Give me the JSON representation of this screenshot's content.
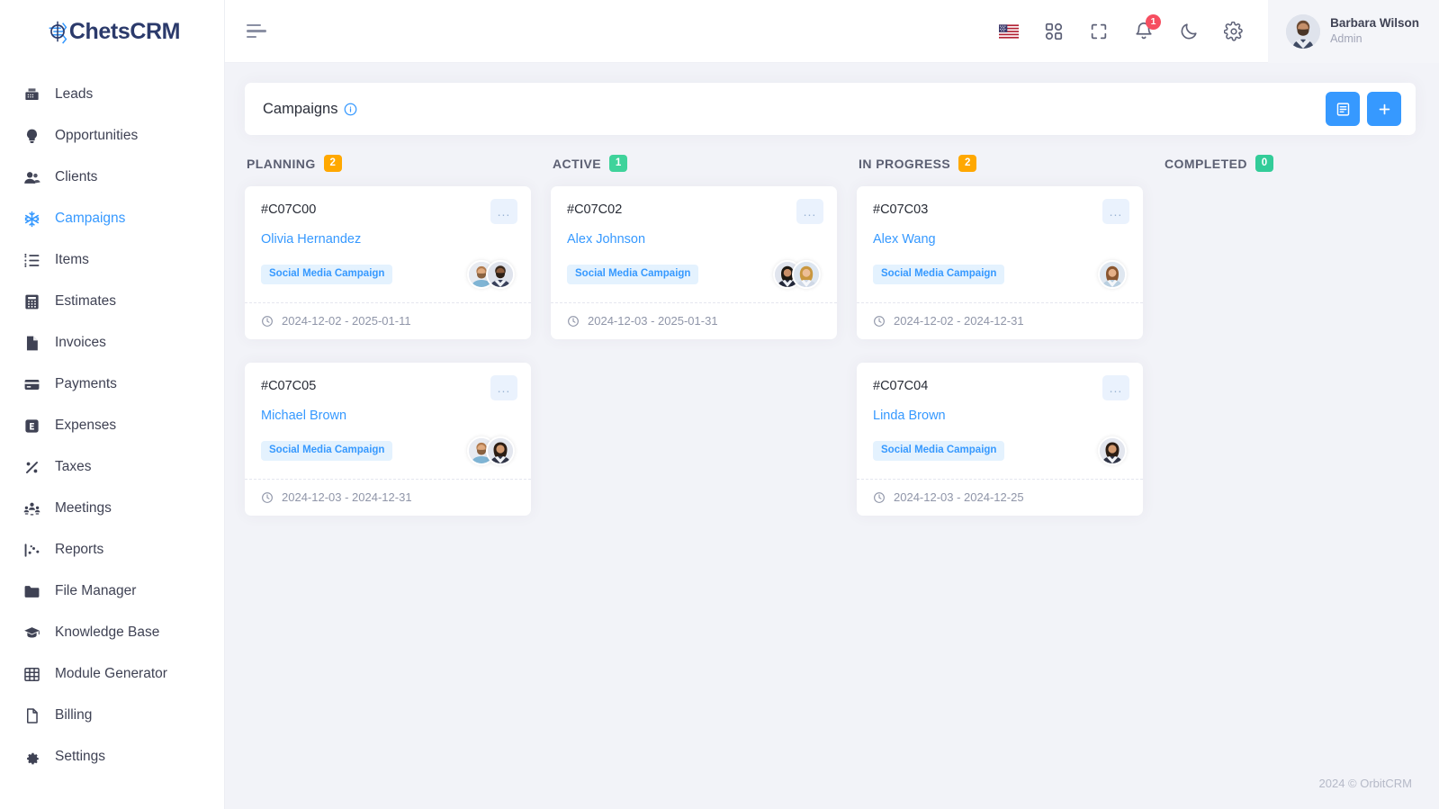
{
  "brand": {
    "name_prefix": "C",
    "name": "hetsCRM",
    "full": "ChetsCRM",
    "color": "#2b3a6b",
    "accent": "#3699ff"
  },
  "sidebar": {
    "items": [
      {
        "label": "Leads",
        "icon": "fax-icon",
        "active": false
      },
      {
        "label": "Opportunities",
        "icon": "lightbulb-icon",
        "active": false
      },
      {
        "label": "Clients",
        "icon": "users-icon",
        "active": false
      },
      {
        "label": "Campaigns",
        "icon": "snowflake-icon",
        "active": true
      },
      {
        "label": "Items",
        "icon": "list-icon",
        "active": false
      },
      {
        "label": "Estimates",
        "icon": "calculator-icon",
        "active": false
      },
      {
        "label": "Invoices",
        "icon": "file-icon",
        "active": false
      },
      {
        "label": "Payments",
        "icon": "credit-card-icon",
        "active": false
      },
      {
        "label": "Expenses",
        "icon": "expense-icon",
        "active": false
      },
      {
        "label": "Taxes",
        "icon": "percent-icon",
        "active": false
      },
      {
        "label": "Meetings",
        "icon": "people-group-icon",
        "active": false
      },
      {
        "label": "Reports",
        "icon": "chart-icon",
        "active": false
      },
      {
        "label": "File Manager",
        "icon": "folder-icon",
        "active": false
      },
      {
        "label": "Knowledge Base",
        "icon": "graduation-cap-icon",
        "active": false
      },
      {
        "label": "Module Generator",
        "icon": "grid-table-icon",
        "active": false
      },
      {
        "label": "Billing",
        "icon": "document-icon",
        "active": false
      },
      {
        "label": "Settings",
        "icon": "gear-icon",
        "active": false
      }
    ]
  },
  "topbar": {
    "menu_toggle": "hamburger-icon",
    "icons": [
      {
        "name": "language-flag-us",
        "label": "US"
      },
      {
        "name": "apps-grid-icon",
        "label": "Apps"
      },
      {
        "name": "fullscreen-icon",
        "label": "Fullscreen"
      },
      {
        "name": "notifications-bell-icon",
        "label": "Notifications",
        "badge": "1"
      },
      {
        "name": "dark-mode-moon-icon",
        "label": "Dark mode"
      },
      {
        "name": "settings-gear-icon",
        "label": "Settings"
      }
    ],
    "notification_count": "1",
    "profile": {
      "name": "Barbara Wilson",
      "role": "Admin"
    }
  },
  "page": {
    "title": "Campaigns",
    "info_tooltip_icon": "info-circle-icon",
    "actions": [
      {
        "name": "list-view-button",
        "icon": "list-view-icon"
      },
      {
        "name": "add-campaign-button",
        "icon": "plus-icon",
        "label": "+"
      }
    ]
  },
  "board": {
    "columns": [
      {
        "title": "PLANNING",
        "count": "2",
        "count_color": "#ffa800",
        "cards": [
          {
            "id": "#C07C00",
            "person": "Olivia Hernandez",
            "tag": "Social Media Campaign",
            "date_range": "2024-12-02 - 2025-01-11",
            "menu": "...",
            "avatars": [
              "male-beard-avatar",
              "male-dark-avatar"
            ]
          },
          {
            "id": "#C07C05",
            "person": "Michael Brown",
            "tag": "Social Media Campaign",
            "date_range": "2024-12-03 - 2024-12-31",
            "menu": "...",
            "avatars": [
              "male-beard-avatar",
              "female-curly-avatar"
            ]
          }
        ]
      },
      {
        "title": "ACTIVE",
        "count": "1",
        "count_color": "#3fd39b",
        "cards": [
          {
            "id": "#C07C02",
            "person": "Alex Johnson",
            "tag": "Social Media Campaign",
            "date_range": "2024-12-03 - 2025-01-31",
            "menu": "...",
            "avatars": [
              "female-dark-avatar",
              "female-blonde-avatar"
            ]
          }
        ]
      },
      {
        "title": "IN PROGRESS",
        "count": "2",
        "count_color": "#ffa800",
        "cards": [
          {
            "id": "#C07C03",
            "person": "Alex Wang",
            "tag": "Social Media Campaign",
            "date_range": "2024-12-02 - 2024-12-31",
            "menu": "...",
            "avatars": [
              "female-longhair-avatar"
            ]
          },
          {
            "id": "#C07C04",
            "person": "Linda Brown",
            "tag": "Social Media Campaign",
            "date_range": "2024-12-03 - 2024-12-25",
            "menu": "...",
            "avatars": [
              "female-curly-avatar"
            ]
          }
        ]
      },
      {
        "title": "COMPLETED",
        "count": "0",
        "count_color": "#33cc99",
        "cards": []
      }
    ]
  },
  "footer": {
    "copyright": "2024 © OrbitCRM"
  }
}
